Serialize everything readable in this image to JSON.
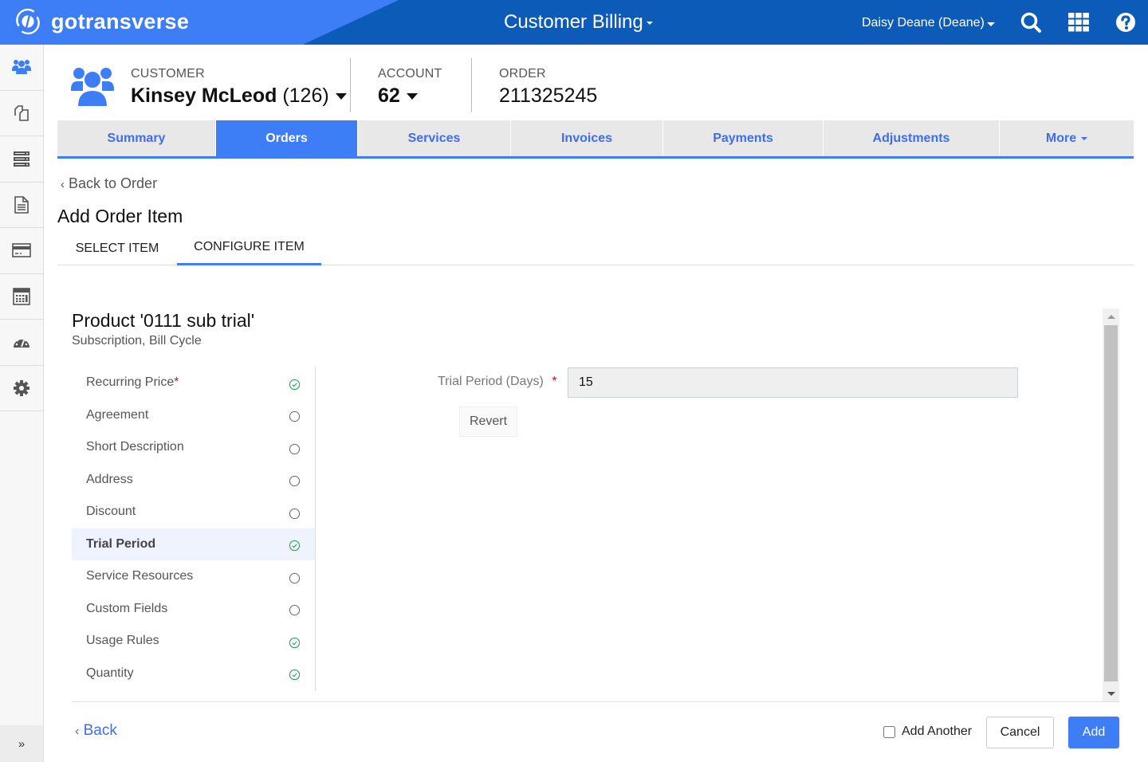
{
  "topbar": {
    "brand": "gotransverse",
    "app_title": "Customer Billing",
    "user": "Daisy Deane (Deane)",
    "icons": [
      "search-icon",
      "apps-grid-icon",
      "help-icon"
    ],
    "colors": {
      "bar": "#0d5bb8",
      "brand_bg": "#3d7ef7"
    }
  },
  "leftnav": {
    "items": [
      {
        "name": "customers",
        "icon": "users-icon",
        "active": true
      },
      {
        "name": "orders",
        "icon": "copy-icon"
      },
      {
        "name": "services",
        "icon": "server-icon"
      },
      {
        "name": "invoices",
        "icon": "document-icon"
      },
      {
        "name": "payments",
        "icon": "credit-card-icon"
      },
      {
        "name": "calculator",
        "icon": "calculator-icon"
      },
      {
        "name": "dashboard",
        "icon": "dashboard-icon"
      },
      {
        "name": "settings",
        "icon": "gear-icon"
      }
    ],
    "expand": "»"
  },
  "header": {
    "customer": {
      "label": "CUSTOMER",
      "name": "Kinsey McLeod",
      "id": "(126)"
    },
    "account": {
      "label": "ACCOUNT",
      "value": "62"
    },
    "order": {
      "label": "ORDER",
      "value": "211325245"
    }
  },
  "main_tabs": [
    {
      "label": "Summary"
    },
    {
      "label": "Orders",
      "active": true
    },
    {
      "label": "Services"
    },
    {
      "label": "Invoices"
    },
    {
      "label": "Payments"
    },
    {
      "label": "Adjustments"
    },
    {
      "label": "More"
    }
  ],
  "back_to_order": "Back to Order",
  "page_title": "Add Order Item",
  "sub_tabs": [
    {
      "label": "SELECT ITEM"
    },
    {
      "label": "CONFIGURE ITEM",
      "active": true
    }
  ],
  "product": {
    "title": "Product '0111 sub trial'",
    "subtitle": "Subscription, Bill Cycle"
  },
  "steps": [
    {
      "label": "Recurring Price",
      "required": true,
      "complete": true
    },
    {
      "label": "Agreement",
      "complete": false
    },
    {
      "label": "Short Description",
      "complete": false
    },
    {
      "label": "Address",
      "complete": false
    },
    {
      "label": "Discount",
      "complete": false
    },
    {
      "label": "Trial Period",
      "complete": true,
      "active": true
    },
    {
      "label": "Service Resources",
      "complete": false
    },
    {
      "label": "Custom Fields",
      "complete": false
    },
    {
      "label": "Usage Rules",
      "complete": true
    },
    {
      "label": "Quantity",
      "complete": true
    }
  ],
  "form": {
    "label": "Trial Period (Days)",
    "required_mark": "*",
    "value": "15",
    "revert": "Revert"
  },
  "footer": {
    "back": "Back",
    "add_another": "Add Another",
    "add_another_checked": false,
    "cancel": "Cancel",
    "add": "Add"
  },
  "colors": {
    "accent": "#3d7ef7",
    "success": "#2ea35f",
    "required": "#c8102e"
  }
}
